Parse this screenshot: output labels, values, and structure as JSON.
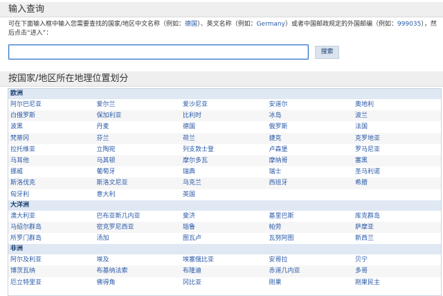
{
  "search": {
    "title": "输入查询",
    "instruction_1": "可在下面输入框中输入您需要查找的国家/地区中文名称（例如：",
    "example_cn": "德国",
    "instruction_2": "）、英文名称（例如：",
    "example_en": "Germany",
    "instruction_3": "）或者中国邮政规定的外国邮编（例如：",
    "example_code": "999035",
    "instruction_4": "），然后点击“进入”：",
    "input_value": "",
    "button_label": "搜索"
  },
  "browse": {
    "title": "按国家/地区所在地理位置划分",
    "regions": [
      {
        "name": "欧洲",
        "rows": [
          [
            "阿尔巴尼亚",
            "爱尔兰",
            "爱沙尼亚",
            "安道尔",
            "奥地利"
          ],
          [
            "白俄罗斯",
            "保加利亚",
            "比利时",
            "冰岛",
            "波兰"
          ],
          [
            "波黑",
            "丹麦",
            "德国",
            "俄罗斯",
            "法国"
          ],
          [
            "梵蒂冈",
            "芬兰",
            "荷兰",
            "捷克",
            "克罗地亚"
          ],
          [
            "拉托维亚",
            "立陶宛",
            "列支敦士登",
            "卢森堡",
            "罗马尼亚"
          ],
          [
            "马耳他",
            "马其顿",
            "摩尔多瓦",
            "摩纳哥",
            "塞黑"
          ],
          [
            "挪威",
            "葡萄牙",
            "瑞典",
            "瑞士",
            "圣马利诺"
          ],
          [
            "斯洛伐克",
            "斯洛文尼亚",
            "乌克兰",
            "西班牙",
            "希腊"
          ],
          [
            "匈牙利",
            "意大利",
            "英国",
            "",
            ""
          ]
        ]
      },
      {
        "name": "大洋洲",
        "rows": [
          [
            "澳大利亚",
            "巴布亚新几内亚",
            "斐济",
            "基里巴斯",
            "库克群岛"
          ],
          [
            "马绍尔群岛",
            "密克罗尼西亚",
            "瑙鲁",
            "帕劳",
            "萨摩亚"
          ],
          [
            "所罗门群岛",
            "汤加",
            "图瓦卢",
            "瓦努阿图",
            "新西兰"
          ]
        ]
      },
      {
        "name": "非洲",
        "rows": [
          [
            "阿尔及利亚",
            "埃及",
            "埃塞俄比亚",
            "安哥拉",
            "贝宁"
          ],
          [
            "博茨瓦纳",
            "布基纳法索",
            "布隆迪",
            "赤道几内亚",
            "多哥"
          ],
          [
            "厄立特里亚",
            "佛得角",
            "冈比亚",
            "刚果",
            "刚果民主"
          ]
        ]
      }
    ]
  }
}
